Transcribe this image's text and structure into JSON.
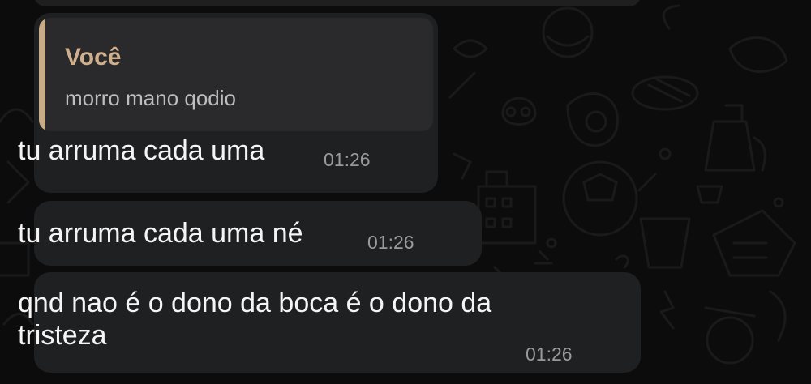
{
  "chat": {
    "theme_colors": {
      "background": "#0c0c0c",
      "bubble": "#1f2022",
      "quote_bar": "#c8ab87",
      "quote_author": "#cfb08c",
      "text": "#f4f4f4",
      "time": "#9a9a9a"
    },
    "messages": [
      {
        "quote": {
          "author": "Você",
          "text": "morro mano qodio"
        },
        "text": "tu arruma cada uma",
        "time": "01:26"
      },
      {
        "text": "tu arruma cada uma né",
        "time": "01:26"
      },
      {
        "text": "qnd nao é o dono da boca é o dono da tristeza",
        "time": "01:26"
      }
    ]
  }
}
